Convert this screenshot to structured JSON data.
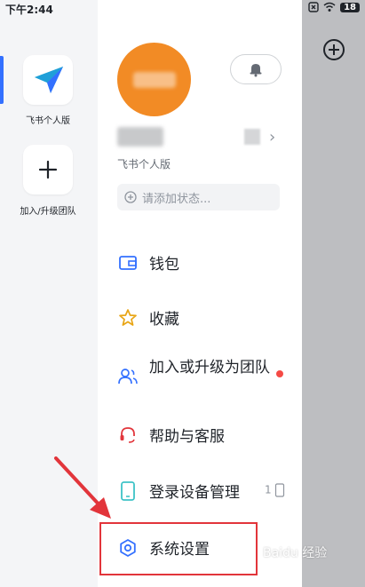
{
  "status_bar": {
    "time": "下午2:44",
    "battery": "18"
  },
  "workspaces": [
    {
      "label": "飞书个人版"
    },
    {
      "label": "加入/升级团队"
    }
  ],
  "profile": {
    "org_name": "飞书个人版"
  },
  "status_input": {
    "placeholder": "请添加状态..."
  },
  "menu": [
    {
      "label": "钱包",
      "icon": "wallet-icon"
    },
    {
      "label": "收藏",
      "icon": "star-icon"
    },
    {
      "label": "加入或升级为团队",
      "icon": "team-icon"
    },
    {
      "label": "帮助与客服",
      "icon": "headset-icon"
    },
    {
      "label": "登录设备管理",
      "icon": "phone-icon"
    },
    {
      "label": "系统设置",
      "icon": "gear-icon"
    }
  ],
  "device_count": "1",
  "watermark": "Baidu 经验",
  "colors": {
    "accent": "#3370ff",
    "avatar": "#f28b25",
    "highlight": "#e2353b",
    "red_dot": "#f54a45"
  }
}
